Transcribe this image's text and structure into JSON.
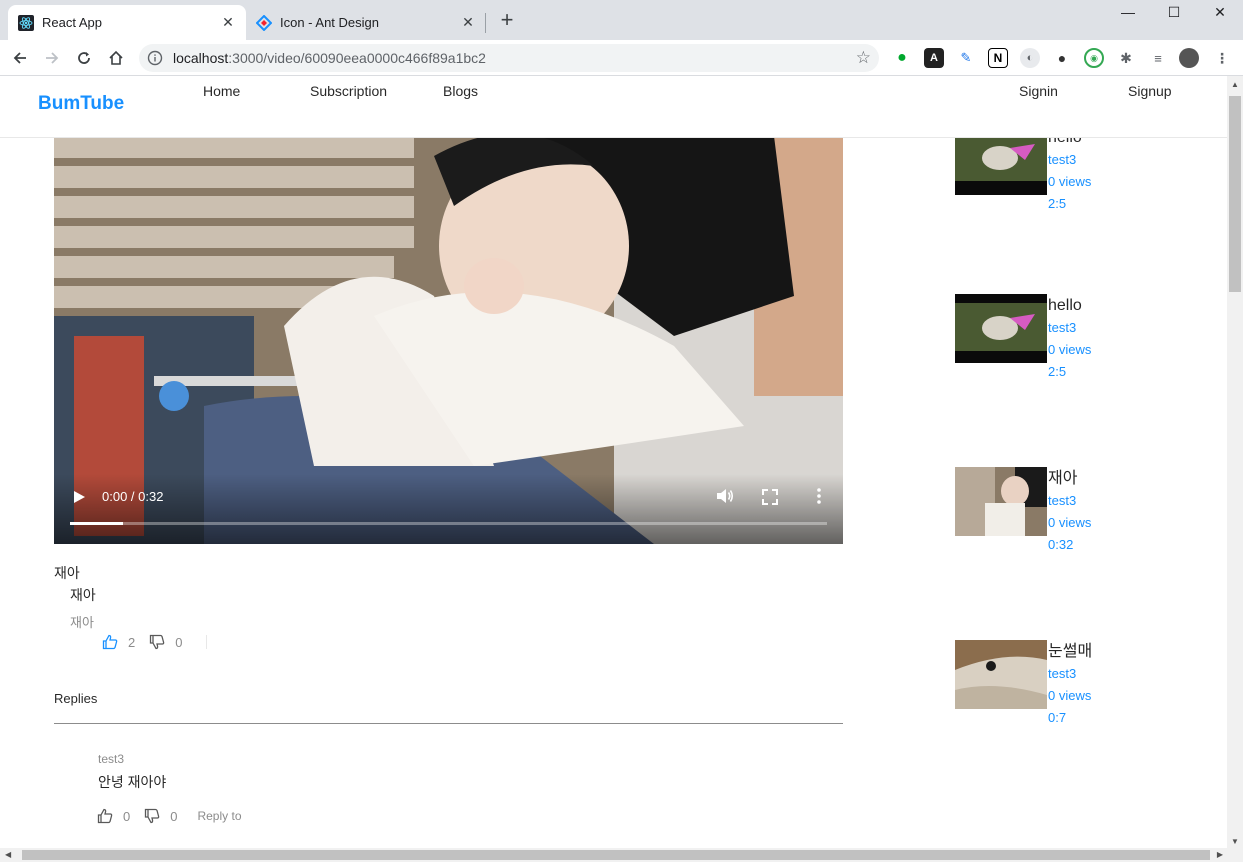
{
  "browser": {
    "tabs": [
      {
        "title": "React App",
        "icon": "react-icon",
        "active": true
      },
      {
        "title": "Icon - Ant Design",
        "icon": "ant-design-icon",
        "active": false
      }
    ],
    "url_host": "localhost",
    "url_path": ":3000/video/60090eea0000c466f89a1bc2"
  },
  "header": {
    "logo": "BumTube",
    "menu": [
      "Home",
      "Subscription",
      "Blogs"
    ],
    "auth": [
      "Signin",
      "Signup"
    ]
  },
  "video": {
    "time": "0:00 / 0:32",
    "progress": 0.07
  },
  "title": "재아",
  "comment": {
    "text": "재아",
    "author": "재아",
    "likes": "2",
    "dislikes": "0"
  },
  "replies_label": "Replies",
  "reply": {
    "author": "test3",
    "text": "안녕 재아야",
    "likes": "0",
    "dislikes": "0",
    "reply_to": "Reply to"
  },
  "sidebar": [
    {
      "title": "hello",
      "author": "test3",
      "views": "0 views",
      "duration": "2:5"
    },
    {
      "title": "hello",
      "author": "test3",
      "views": "0 views",
      "duration": "2:5"
    },
    {
      "title": "재아",
      "author": "test3",
      "views": "0 views",
      "duration": "0:32"
    },
    {
      "title": "눈썰매",
      "author": "test3",
      "views": "0 views",
      "duration": "0:7"
    }
  ],
  "colors": {
    "brand": "#1890ff",
    "like_active": "#1890ff"
  }
}
